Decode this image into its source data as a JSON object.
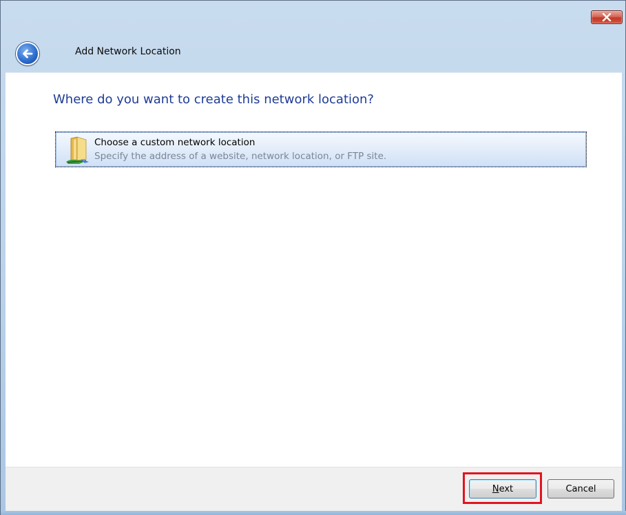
{
  "window": {
    "title": "Add Network Location"
  },
  "wizard": {
    "heading": "Where do you want to create this network location?",
    "options": [
      {
        "title": "Choose a custom network location",
        "description": "Specify the address of a website, network location, or FTP site.",
        "icon": "network-folder-icon"
      }
    ]
  },
  "buttons": {
    "next_mnemonic": "N",
    "next_rest": "ext",
    "cancel": "Cancel"
  },
  "colors": {
    "heading": "#1e3c96",
    "highlight": "#e2141e",
    "close_button": "#c23a28"
  }
}
